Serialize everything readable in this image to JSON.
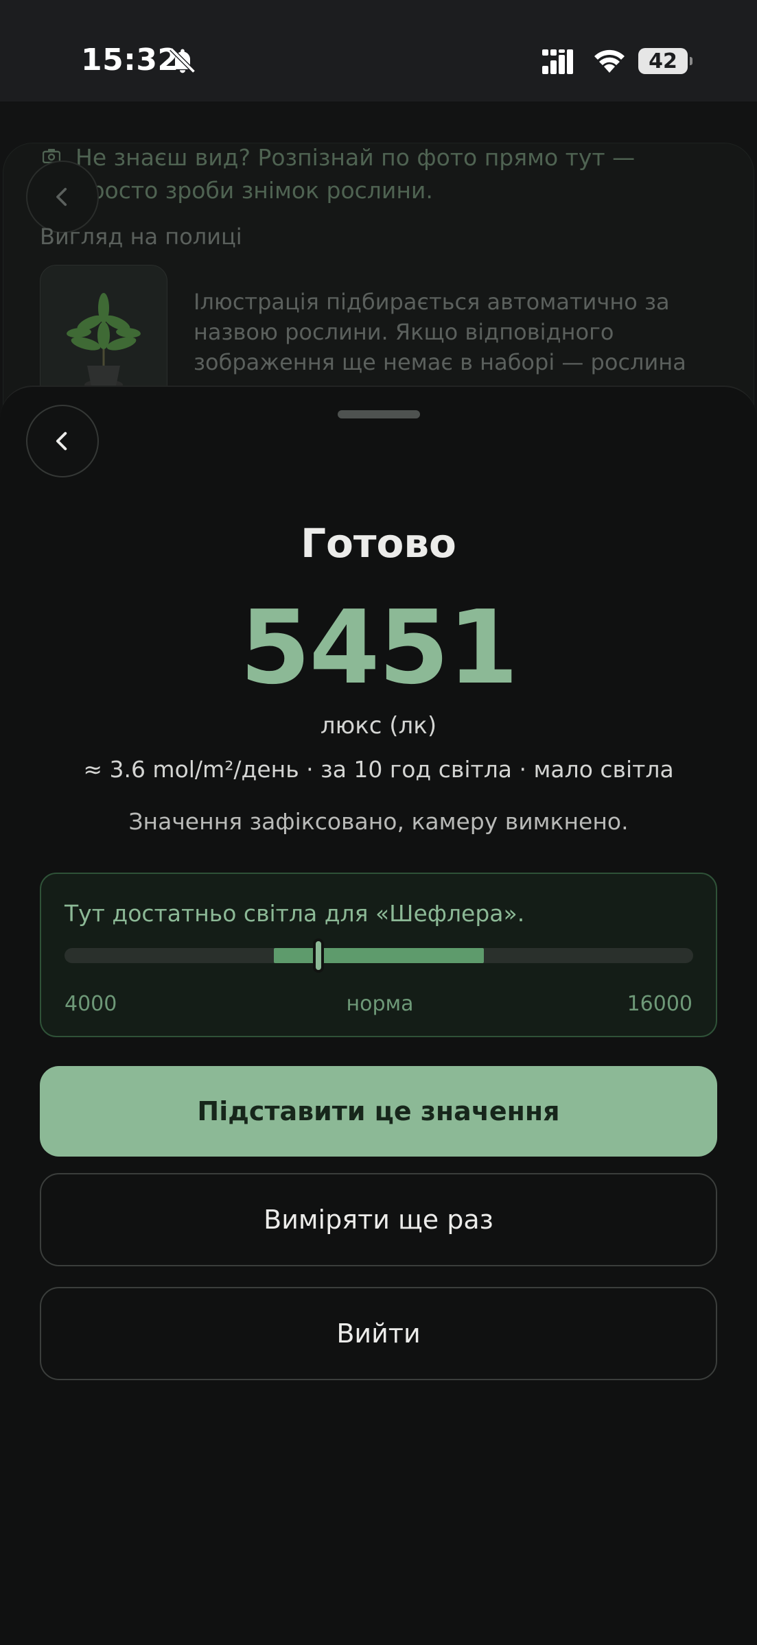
{
  "status_bar": {
    "time": "15:32",
    "battery": "42"
  },
  "background": {
    "hint": "Не знаєш вид? Розпізнай по фото прямо тут — просто зроби знімок рослини.",
    "shelf_label": "Вигляд на полиці",
    "illustration_text": "Ілюстрація підбирається автоматично за назвою рослини. Якщо відповідного зображення ще немає в наборі — рослина"
  },
  "sheet": {
    "title": "Готово",
    "lux_value": "5451",
    "lux_unit": "люкс (лк)",
    "dli_line": "≈ 3.6 mol/m²/день · за 10 год світла · мало світла",
    "frozen_note": "Значення зафіксовано, камеру вимкнено.",
    "range": {
      "message": "Тут достатньо світла для «Шефлера».",
      "min_label": "4000",
      "mid_label": "норма",
      "max_label": "16000",
      "optimal_start_fraction": 0.333,
      "optimal_end_fraction": 0.667,
      "marker_fraction": 0.404
    },
    "buttons": {
      "apply": "Підставити це значення",
      "remeasure": "Виміряти ще раз",
      "exit": "Вийти"
    }
  },
  "colors": {
    "accent": "#8cb996",
    "accent_dark": "#5e9b6c",
    "sheet_bg": "#101111",
    "status_bar_bg": "#1c1d1f"
  },
  "icons": [
    "bell-off-icon",
    "signal-icon",
    "wifi-icon",
    "battery-icon",
    "chevron-left-icon",
    "camera-icon"
  ]
}
